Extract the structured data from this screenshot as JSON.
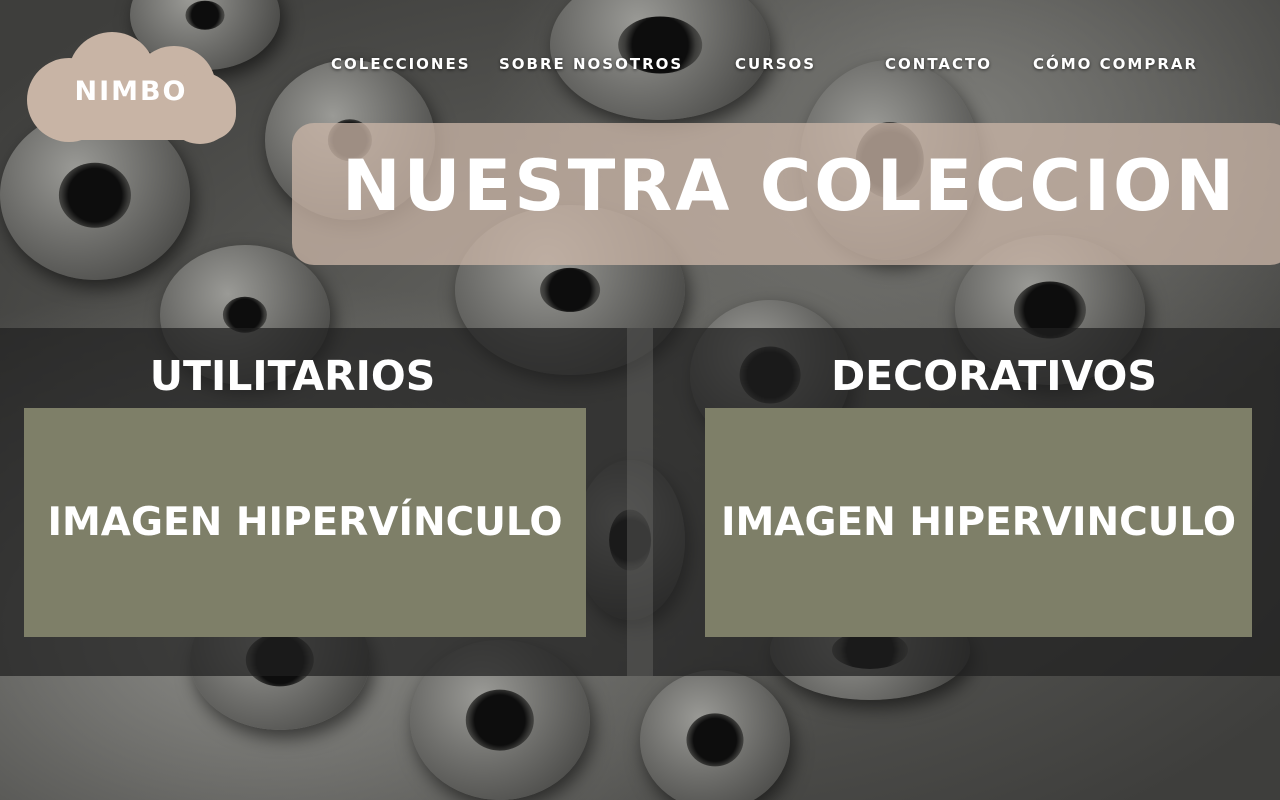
{
  "brand": {
    "name": "NIMBO",
    "cloud_color": "#c8b4a5"
  },
  "nav": {
    "items": [
      {
        "label": "COLECCIONES"
      },
      {
        "label": "SOBRE NOSOTROS"
      },
      {
        "label": "CURSOS"
      },
      {
        "label": "CONTACTO"
      },
      {
        "label": "CÓMO COMPRAR"
      }
    ]
  },
  "banner": {
    "title": "NUESTRA COLECCION",
    "color": "#c8b4a5"
  },
  "sections": [
    {
      "title": "UTILITARIOS",
      "card_label": "IMAGEN HIPERVÍNCULO"
    },
    {
      "title": "DECORATIVOS",
      "card_label": "IMAGEN HIPERVINCULO"
    }
  ],
  "colors": {
    "card": "#7e7f68",
    "band": "#202020",
    "text": "#ffffff"
  }
}
